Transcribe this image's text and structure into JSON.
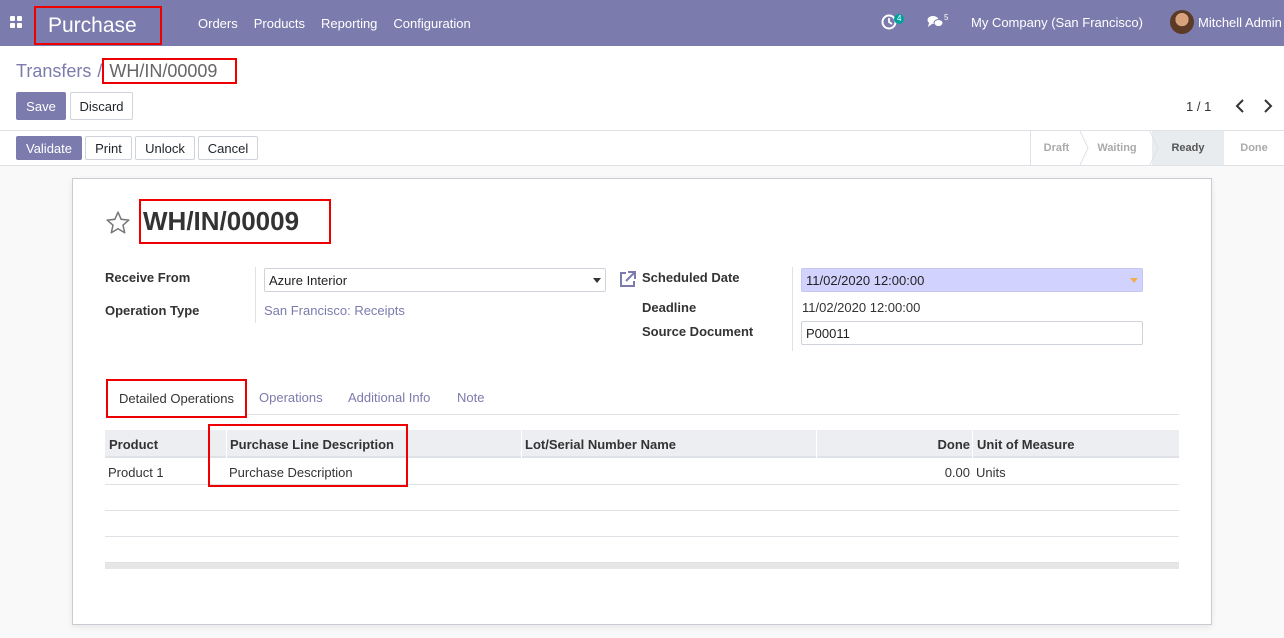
{
  "navbar": {
    "app_name": "Purchase",
    "menu": [
      "Orders",
      "Products",
      "Reporting",
      "Configuration"
    ],
    "activity_count": "4",
    "message_count": "5",
    "company": "My Company (San Francisco)",
    "user": "Mitchell Admin",
    "color": "#7c7bad"
  },
  "breadcrumb": {
    "parent": "Transfers",
    "separator": "/",
    "current": "WH/IN/00009"
  },
  "actions": {
    "save": "Save",
    "discard": "Discard"
  },
  "pager": {
    "text": "1 / 1"
  },
  "statusbar": {
    "buttons": {
      "validate": "Validate",
      "print": "Print",
      "unlock": "Unlock",
      "cancel": "Cancel"
    },
    "stages": [
      "Draft",
      "Waiting",
      "Ready",
      "Done"
    ],
    "active_stage": "Ready"
  },
  "form": {
    "title": "WH/IN/00009",
    "receive_from_label": "Receive From",
    "receive_from_value": "Azure Interior",
    "operation_type_label": "Operation Type",
    "operation_type_value": "San Francisco: Receipts",
    "scheduled_date_label": "Scheduled Date",
    "scheduled_date_value": "11/02/2020 12:00:00",
    "deadline_label": "Deadline",
    "deadline_value": "11/02/2020 12:00:00",
    "source_document_label": "Source Document",
    "source_document_value": "P00011"
  },
  "tabs": [
    "Detailed Operations",
    "Operations",
    "Additional Info",
    "Note"
  ],
  "table": {
    "headers": [
      "Product",
      "Purchase Line Description",
      "Lot/Serial Number Name",
      "Done",
      "Unit of Measure"
    ],
    "rows": [
      {
        "product": "Product 1",
        "description": "Purchase Description",
        "lot": "",
        "done": "0.00",
        "uom": "Units"
      }
    ]
  }
}
